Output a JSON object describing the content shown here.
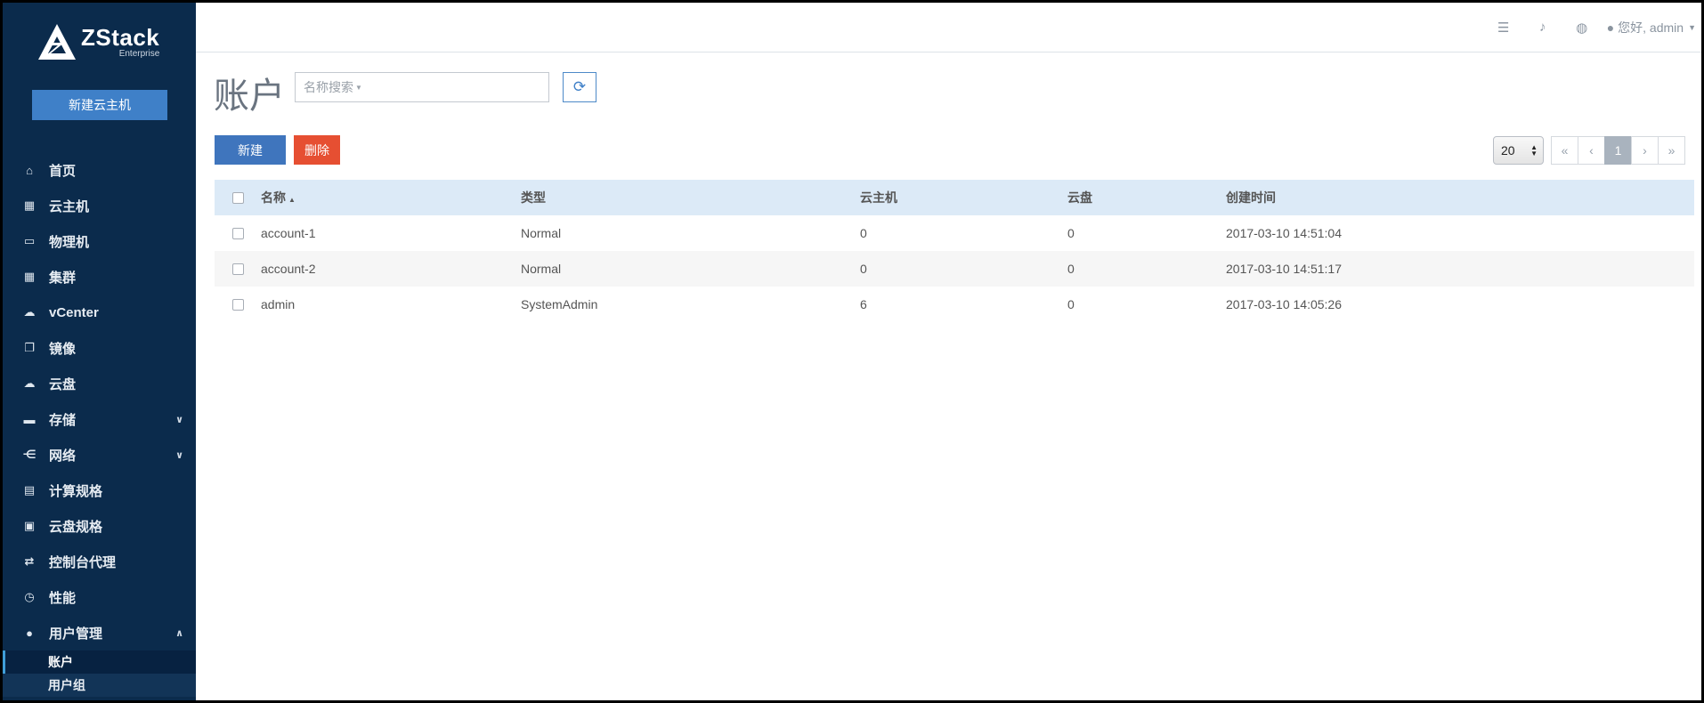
{
  "brand": {
    "name": "ZStack",
    "edition": "Enterprise"
  },
  "sidebar": {
    "new_vm_label": "新建云主机",
    "items": [
      {
        "label": "首页",
        "icon": "home-icon",
        "glyph": "⌂"
      },
      {
        "label": "云主机",
        "icon": "grid-icon",
        "glyph": "▦"
      },
      {
        "label": "物理机",
        "icon": "monitor-icon",
        "glyph": "▭"
      },
      {
        "label": "集群",
        "icon": "cluster-icon",
        "glyph": "▦"
      },
      {
        "label": "vCenter",
        "icon": "cloud-icon",
        "glyph": "☁"
      },
      {
        "label": "镜像",
        "icon": "image-icon",
        "glyph": "❐"
      },
      {
        "label": "云盘",
        "icon": "cloud-upload-icon",
        "glyph": "☁"
      },
      {
        "label": "存储",
        "icon": "storage-icon",
        "glyph": "▬",
        "chevron": "∨"
      },
      {
        "label": "网络",
        "icon": "network-icon",
        "glyph": "⋲",
        "chevron": "∨"
      },
      {
        "label": "计算规格",
        "icon": "calculator-icon",
        "glyph": "▤"
      },
      {
        "label": "云盘规格",
        "icon": "disk-offering-icon",
        "glyph": "▣"
      },
      {
        "label": "控制台代理",
        "icon": "exchange-icon",
        "glyph": "⇄"
      },
      {
        "label": "性能",
        "icon": "clock-icon",
        "glyph": "◷"
      },
      {
        "label": "用户管理",
        "icon": "user-icon",
        "glyph": "●",
        "chevron": "∧"
      }
    ],
    "sub_items": [
      {
        "label": "账户"
      },
      {
        "label": "用户组"
      }
    ]
  },
  "header": {
    "greeting": "您好, admin"
  },
  "main": {
    "title": "账户",
    "search_placeholder": "名称搜索",
    "create_label": "新建",
    "delete_label": "删除",
    "page_size": "20",
    "pager": {
      "first": "«",
      "prev": "‹",
      "current": "1",
      "next": "›",
      "last": "»"
    }
  },
  "table": {
    "headers": {
      "name": "名称",
      "type": "类型",
      "vm": "云主机",
      "disk": "云盘",
      "created": "创建时间"
    },
    "rows": [
      {
        "name": "account-1",
        "type": "Normal",
        "vm": "0",
        "disk": "0",
        "created": "2017-03-10 14:51:04"
      },
      {
        "name": "account-2",
        "type": "Normal",
        "vm": "0",
        "disk": "0",
        "created": "2017-03-10 14:51:17"
      },
      {
        "name": "admin",
        "type": "SystemAdmin",
        "vm": "6",
        "disk": "0",
        "created": "2017-03-10 14:05:26"
      }
    ]
  }
}
